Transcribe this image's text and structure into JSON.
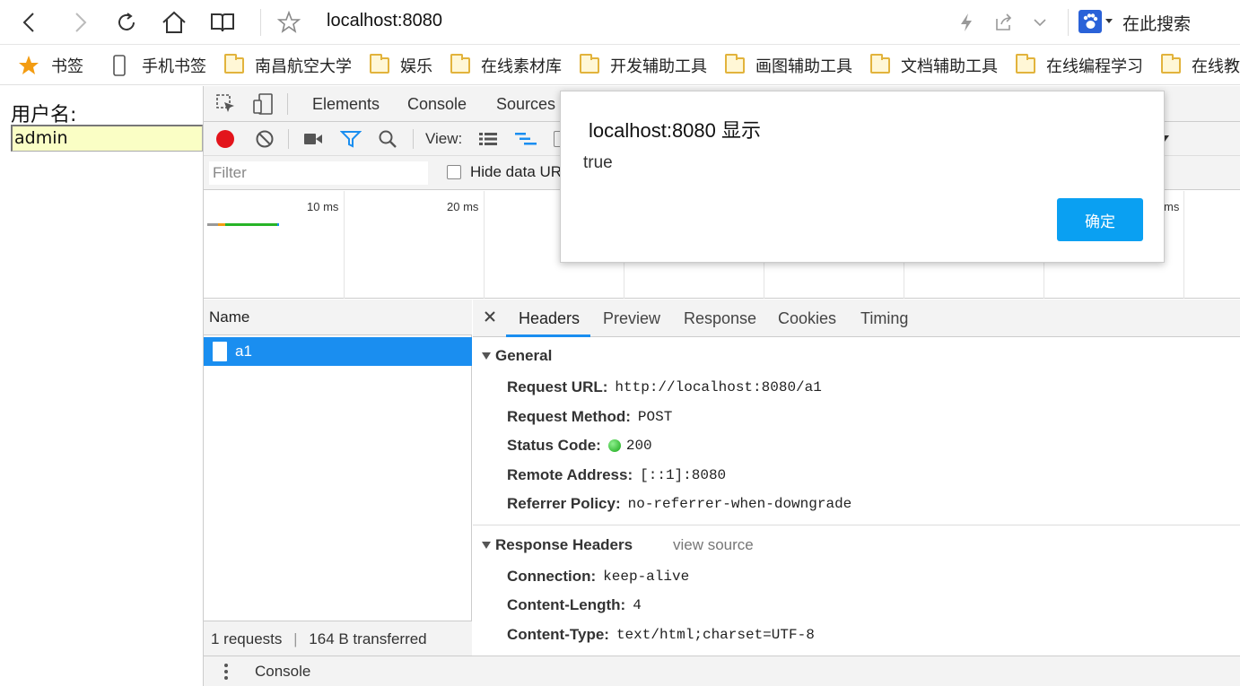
{
  "browser": {
    "url": "localhost:8080",
    "search_placeholder": "在此搜索"
  },
  "bookmarks": {
    "items": [
      {
        "label": "书签",
        "icon": "star-icon"
      },
      {
        "label": "手机书签",
        "icon": "phone-icon"
      },
      {
        "label": "南昌航空大学",
        "icon": "folder-icon"
      },
      {
        "label": "娱乐",
        "icon": "folder-icon"
      },
      {
        "label": "在线素材库",
        "icon": "folder-icon"
      },
      {
        "label": "开发辅助工具",
        "icon": "folder-icon"
      },
      {
        "label": "画图辅助工具",
        "icon": "folder-icon"
      },
      {
        "label": "文档辅助工具",
        "icon": "folder-icon"
      },
      {
        "label": "在线编程学习",
        "icon": "folder-icon"
      },
      {
        "label": "在线教",
        "icon": "folder-icon"
      }
    ]
  },
  "page": {
    "username_label": "用户名:",
    "username_value": "admin"
  },
  "devtools": {
    "tabs": [
      "Elements",
      "Console",
      "Sources"
    ],
    "view_label": "View:",
    "filter_placeholder": "Filter",
    "hide_data_urls": "Hide data UR",
    "timeline_ticks": [
      "10 ms",
      "20 ms",
      "ms"
    ],
    "name_header": "Name",
    "requests": [
      {
        "name": "a1"
      }
    ],
    "status_bar": {
      "requests": "1 requests",
      "transferred": "164 B transferred"
    },
    "detail_tabs": [
      "Headers",
      "Preview",
      "Response",
      "Cookies",
      "Timing"
    ],
    "general": {
      "title": "General",
      "rows": [
        {
          "key": "Request URL:",
          "value": "http://localhost:8080/a1"
        },
        {
          "key": "Request Method:",
          "value": "POST"
        },
        {
          "key": "Status Code:",
          "value": "200"
        },
        {
          "key": "Remote Address:",
          "value": "[::1]:8080"
        },
        {
          "key": "Referrer Policy:",
          "value": "no-referrer-when-downgrade"
        }
      ]
    },
    "response_headers": {
      "title": "Response Headers",
      "view_source": "view source",
      "rows": [
        {
          "key": "Connection:",
          "value": "keep-alive"
        },
        {
          "key": "Content-Length:",
          "value": "4"
        },
        {
          "key": "Content-Type:",
          "value": "text/html;charset=UTF-8"
        }
      ]
    },
    "drawer_label": "Console"
  },
  "alert": {
    "title": "localhost:8080 显示",
    "message": "true",
    "ok_label": "确定"
  },
  "colors": {
    "accent": "#1a8ef0",
    "alert_button": "#0aa0f2",
    "record": "#e3141b",
    "input_autofill": "#fafec5"
  }
}
